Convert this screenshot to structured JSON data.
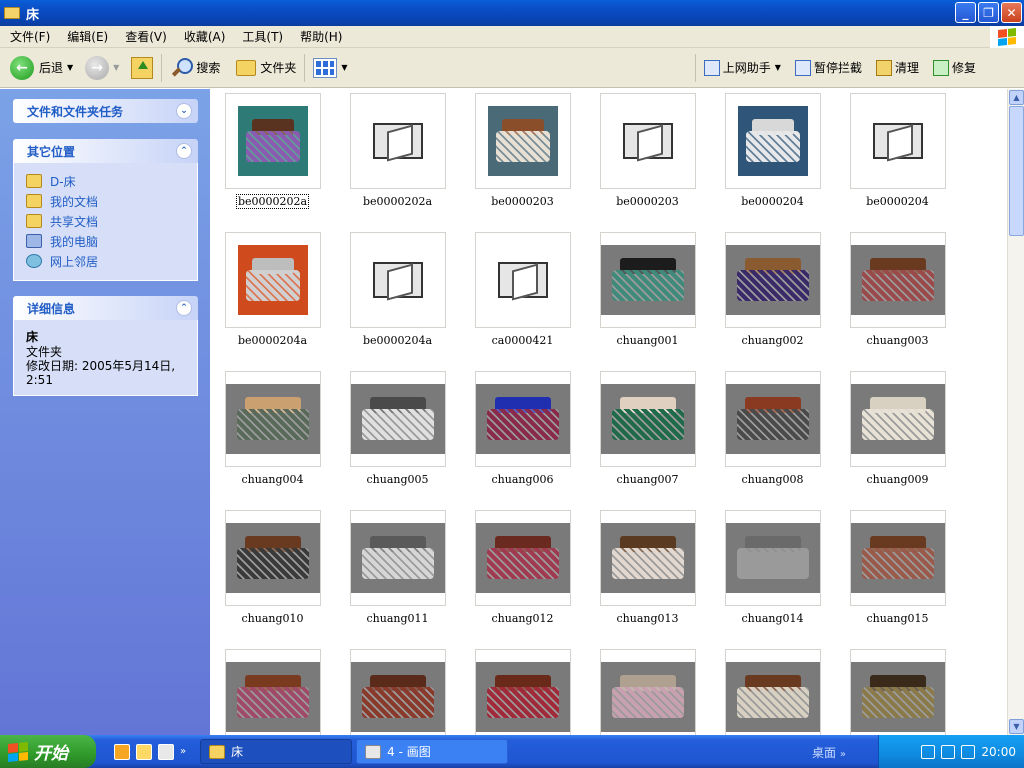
{
  "window": {
    "title": "床"
  },
  "menu": [
    "文件(F)",
    "编辑(E)",
    "查看(V)",
    "收藏(A)",
    "工具(T)",
    "帮助(H)"
  ],
  "toolbar": {
    "back": "后退",
    "search": "搜索",
    "folders": "文件夹",
    "assist": "上网助手",
    "pause_block": "暂停拦截",
    "clean": "清理",
    "repair": "修复"
  },
  "left_panel": {
    "tasks_title": "文件和文件夹任务",
    "places_title": "其它位置",
    "places": [
      "D-床",
      "我的文档",
      "共享文档",
      "我的电脑",
      "网上邻居"
    ],
    "details_title": "详细信息",
    "details": {
      "name": "床",
      "type": "文件夹",
      "modified": "修改日期: 2005年5月14日,",
      "time": "2:51"
    }
  },
  "files": [
    "be0000202a",
    "be0000202a",
    "be0000203",
    "be0000203",
    "be0000204",
    "be0000204",
    "be0000204a",
    "be0000204a",
    "ca0000421",
    "chuang001",
    "chuang002",
    "chuang003",
    "chuang004",
    "chuang005",
    "chuang006",
    "chuang007",
    "chuang008",
    "chuang009",
    "chuang010",
    "chuang011",
    "chuang012",
    "chuang013",
    "chuang014",
    "chuang015",
    "",
    "",
    "",
    "",
    "",
    ""
  ],
  "taskbar": {
    "start": "开始",
    "task1": "床",
    "task2": "4 - 画图",
    "desktop": "桌面",
    "time": "20:00"
  },
  "colors": {
    "titlebar": "#0a4cc4",
    "sidebar": "#6f8de0",
    "sidebar_link": "#215dc6",
    "taskbar": "#245edb",
    "start_button": "#2f9a2a"
  }
}
